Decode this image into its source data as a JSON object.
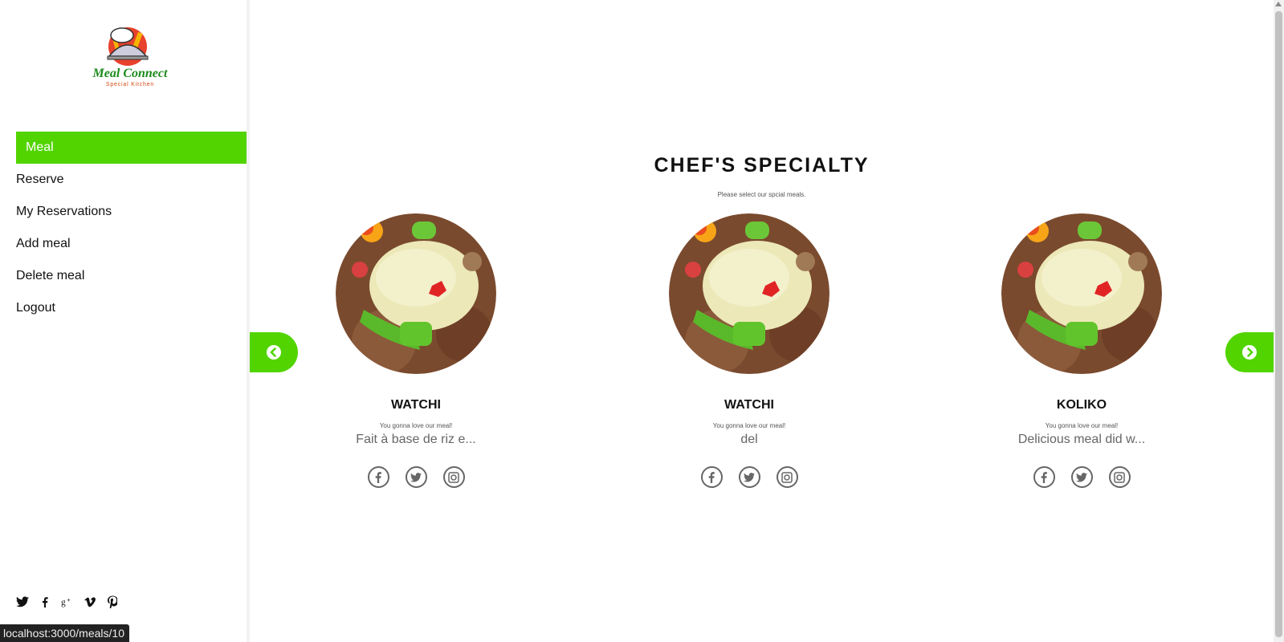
{
  "brand": {
    "name": "Meal Connect",
    "tagline": "Special Kitchen"
  },
  "nav": {
    "items": [
      {
        "label": "Meal",
        "active": true
      },
      {
        "label": "Reserve"
      },
      {
        "label": "My Reservations"
      },
      {
        "label": "Add meal"
      },
      {
        "label": "Delete meal"
      },
      {
        "label": "Logout"
      }
    ]
  },
  "social_icons": [
    "twitter-icon",
    "facebook-icon",
    "google-plus-icon",
    "vimeo-icon",
    "pinterest-icon"
  ],
  "status_url": "localhost:3000/meals/10",
  "main": {
    "title": "CHEF'S SPECIALTY",
    "subtitle": "Please select our spcial meals.",
    "meals": [
      {
        "name": "WATCHI",
        "tagline": "You gonna love our meal!",
        "description": "Fait à base de riz e..."
      },
      {
        "name": "WATCHI",
        "tagline": "You gonna love our meal!",
        "description": "del"
      },
      {
        "name": "KOLIKO",
        "tagline": "You gonna love our meal!",
        "description": "Delicious meal did w..."
      }
    ],
    "card_icons": [
      "facebook-icon",
      "twitter-icon",
      "instagram-icon"
    ]
  },
  "colors": {
    "accent": "#52d400"
  }
}
